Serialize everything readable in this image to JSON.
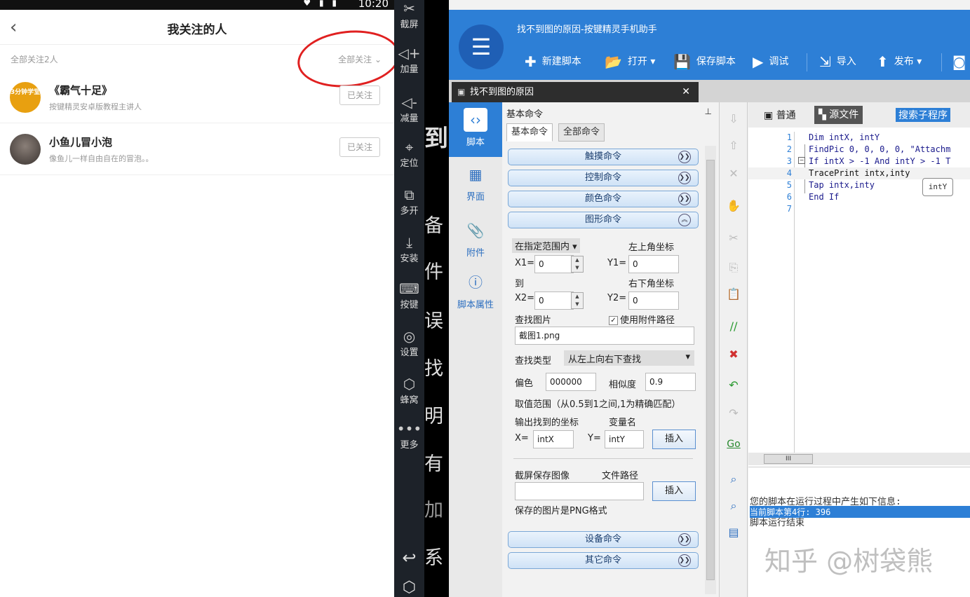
{
  "phone": {
    "status_time": "10:20",
    "status_icons": "♥ ▮ ▮",
    "title": "我关注的人",
    "follow_count": "全部关注2人",
    "filter_label": "全部关注 ⌄",
    "following": [
      {
        "avatar_text": "3分钟学堂",
        "name": "《霸气十足》",
        "desc": "按键精灵安卓版教程主讲人",
        "button": "已关注"
      },
      {
        "avatar_text": "",
        "name": "小鱼儿冒小泡",
        "desc": "像鱼儿一样自由自在的冒泡。。",
        "button": "已关注"
      }
    ],
    "annotation_color": "#e02020"
  },
  "emulator_tools": [
    {
      "icon": "scissors-icon",
      "glyph": "✂",
      "label": "截屏"
    },
    {
      "icon": "volume-up-icon",
      "glyph": "◁+",
      "label": "加量"
    },
    {
      "icon": "volume-down-icon",
      "glyph": "◁-",
      "label": "减量"
    },
    {
      "icon": "location-icon",
      "glyph": "⌖",
      "label": "定位"
    },
    {
      "icon": "multi-open-icon",
      "glyph": "⧉",
      "label": "多开"
    },
    {
      "icon": "apk-install-icon",
      "glyph": "⤓",
      "label": "安装"
    },
    {
      "icon": "keyboard-icon",
      "glyph": "⌨",
      "label": "按键"
    },
    {
      "icon": "settings-icon",
      "glyph": "◎",
      "label": "设置"
    },
    {
      "icon": "hive-icon",
      "glyph": "⬡",
      "label": "蜂窝"
    },
    {
      "icon": "more-icon",
      "glyph": "•••",
      "label": "更多"
    }
  ],
  "background_chars": [
    "到",
    "备",
    "件",
    "误",
    "找",
    "明",
    "有",
    "加",
    "系"
  ],
  "editor": {
    "window_title": "找不到图的原因-按键精灵手机助手",
    "toolbar": [
      {
        "icon": "plus-icon",
        "glyph": "✚",
        "label": "新建脚本"
      },
      {
        "icon": "folder-icon",
        "glyph": "📂",
        "label": "打开 ▾"
      },
      {
        "icon": "save-icon",
        "glyph": "💾",
        "label": "保存脚本"
      },
      {
        "icon": "play-icon",
        "glyph": "▶",
        "label": "调试"
      },
      {
        "icon": "import-icon",
        "glyph": "⇲",
        "label": "导入"
      },
      {
        "icon": "publish-icon",
        "glyph": "⬆",
        "label": "发布 ▾"
      }
    ],
    "doc_tab": "找不到图的原因",
    "left_nav": [
      {
        "icon": "script-icon",
        "glyph": "‹›",
        "label": "脚本"
      },
      {
        "icon": "ui-icon",
        "glyph": "▦",
        "label": "界面"
      },
      {
        "icon": "attachment-icon",
        "glyph": "📎",
        "label": "附件"
      },
      {
        "icon": "info-icon",
        "glyph": "ⓘ",
        "label": "脚本属性"
      }
    ],
    "command_panel": {
      "header": "基本命令",
      "tabs": [
        "基本命令",
        "全部命令"
      ],
      "groups": [
        "触摸命令",
        "控制命令",
        "颜色命令",
        "图形命令"
      ],
      "bottom_groups": [
        "设备命令",
        "其它命令"
      ],
      "range_select": "在指定范围内",
      "top_left_label": "左上角坐标",
      "x1_label": "X1=",
      "x1_value": "0",
      "y1_label": "Y1=",
      "y1_value": "0",
      "to_label": "到",
      "bottom_right_label": "右下角坐标",
      "x2_label": "X2=",
      "x2_value": "0",
      "y2_label": "Y2=",
      "y2_value": "0",
      "find_image_label": "查找图片",
      "use_attach_path": "使用附件路径",
      "image_file": "截图1.png",
      "find_type_label": "查找类型",
      "find_type_value": "从左上向右下查找",
      "color_offset_label": "偏色",
      "color_offset_value": "000000",
      "similarity_label": "相似度",
      "similarity_value": "0.9",
      "range_note": "取值范围（从0.5到1之间,1为精确匹配）",
      "output_coord_label": "输出找到的坐标",
      "var_name_label": "变量名",
      "x_label": "X=",
      "x_var": "intX",
      "y_label": "Y=",
      "y_var": "intY",
      "insert_label": "插入",
      "screenshot_label": "截屏保存图像",
      "file_path_label": "文件路径",
      "insert_label_2": "插入",
      "png_note": "保存的图片是PNG格式"
    },
    "code_toolbar": {
      "normal": "普通",
      "source": "源文件",
      "search": "搜索子程序"
    },
    "code_lines": [
      {
        "n": "1",
        "text": "Dim intX, intY"
      },
      {
        "n": "2",
        "text": "FindPic 0, 0, 0, 0, \"Attachm"
      },
      {
        "n": "3",
        "text": "If intX > -1 And intY > -1 T"
      },
      {
        "n": "4",
        "text": "TracePrint intx,inty"
      },
      {
        "n": "5",
        "text": "Tap intx,inty"
      },
      {
        "n": "6",
        "text": "End If"
      },
      {
        "n": "7",
        "text": ""
      }
    ],
    "autocomplete": "intY",
    "output": [
      "您的脚本在运行过程中产生如下信息:",
      "当前脚本第4行: 396",
      "脚本运行结束"
    ],
    "accent": "#2d7fd6"
  },
  "watermark": "知乎 @树袋熊"
}
